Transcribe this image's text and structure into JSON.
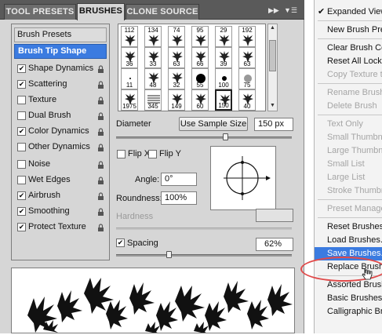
{
  "tabs": [
    {
      "label": "TOOL PRESETS",
      "active": false
    },
    {
      "label": "BRUSHES",
      "active": true
    },
    {
      "label": "CLONE SOURCE",
      "active": false
    }
  ],
  "tab_icons": {
    "collapse": "double-arrow-icon",
    "menu": "panel-menu-icon"
  },
  "left_list": {
    "header": "Brush Presets",
    "selected": "Brush Tip Shape",
    "options": [
      {
        "label": "Shape Dynamics",
        "checked": true
      },
      {
        "label": "Scattering",
        "checked": true
      },
      {
        "label": "Texture",
        "checked": false
      },
      {
        "label": "Dual Brush",
        "checked": false
      },
      {
        "label": "Color Dynamics",
        "checked": true
      },
      {
        "label": "Other Dynamics",
        "checked": false
      },
      {
        "label": "Noise",
        "checked": false
      },
      {
        "label": "Wet Edges",
        "checked": false
      },
      {
        "label": "Airbrush",
        "checked": true
      },
      {
        "label": "Smoothing",
        "checked": true
      },
      {
        "label": "Protect Texture",
        "checked": true
      }
    ]
  },
  "brush_grid": {
    "row1": [
      "112",
      "134",
      "74",
      "95",
      "29",
      "192"
    ],
    "row2": [
      "36",
      "33",
      "63",
      "66",
      "39",
      "63"
    ],
    "row3": [
      "11",
      "48",
      "32",
      "55",
      "100",
      "75"
    ],
    "row4": [
      "1975",
      "345",
      "149",
      "60",
      "150",
      "40"
    ],
    "selected_index": 22
  },
  "diameter": {
    "label": "Diameter",
    "button": "Use Sample Size",
    "value": "150 px"
  },
  "flip": {
    "x_label": "Flip X",
    "y_label": "Flip Y",
    "x_checked": false,
    "y_checked": false
  },
  "angle": {
    "label": "Angle:",
    "value": "0°"
  },
  "roundness": {
    "label": "Roundness:",
    "value": "100%"
  },
  "hardness": {
    "label": "Hardness"
  },
  "spacing": {
    "label": "Spacing",
    "checked": true,
    "value": "62%"
  },
  "menu": {
    "items": [
      {
        "label": "Expanded View",
        "state": "checked"
      },
      {
        "sep": true
      },
      {
        "label": "New Brush Preset...",
        "state": "enabled"
      },
      {
        "sep": true
      },
      {
        "label": "Clear Brush Controls",
        "state": "enabled"
      },
      {
        "label": "Reset All Locked Settings",
        "state": "enabled"
      },
      {
        "label": "Copy Texture to Other Tools",
        "state": "disabled"
      },
      {
        "sep": true
      },
      {
        "label": "Rename Brush...",
        "state": "disabled"
      },
      {
        "label": "Delete Brush",
        "state": "disabled"
      },
      {
        "sep": true
      },
      {
        "label": "Text Only",
        "state": "disabled"
      },
      {
        "label": "Small Thumbnail",
        "state": "disabled"
      },
      {
        "label": "Large Thumbnail",
        "state": "disabled"
      },
      {
        "label": "Small List",
        "state": "disabled"
      },
      {
        "label": "Large List",
        "state": "disabled"
      },
      {
        "label": "Stroke Thumbnail",
        "state": "disabled"
      },
      {
        "sep": true
      },
      {
        "label": "Preset Manager...",
        "state": "disabled"
      },
      {
        "sep": true
      },
      {
        "label": "Reset Brushes...",
        "state": "enabled"
      },
      {
        "label": "Load Brushes...",
        "state": "enabled"
      },
      {
        "label": "Save Brushes...",
        "state": "highlighted"
      },
      {
        "label": "Replace Brushes...",
        "state": "enabled"
      },
      {
        "sep": true
      },
      {
        "label": "Assorted Brushes",
        "state": "enabled"
      },
      {
        "label": "Basic Brushes",
        "state": "enabled"
      },
      {
        "label": "Calligraphic Brushes",
        "state": "enabled"
      }
    ]
  },
  "annotation_color": "#e04a4a",
  "highlight_color": "#3b7be0"
}
